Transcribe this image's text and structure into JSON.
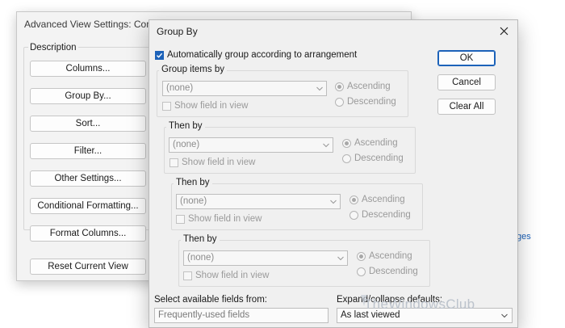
{
  "background_dialog": {
    "title": "Advanced View Settings: Com",
    "description_label": "Description",
    "buttons": [
      "Columns...",
      "Group By...",
      "Sort...",
      "Filter...",
      "Other Settings...",
      "Conditional Formatting...",
      "Format Columns..."
    ],
    "reset_label": "Reset Current View",
    "right_link_partial": "ges"
  },
  "dialog": {
    "title": "Group By",
    "auto_group_label": "Automatically group according to arrangement",
    "auto_group_checked": true,
    "groups": [
      {
        "label": "Group items by",
        "value": "(none)",
        "show_field": "Show field in view",
        "ascending": "Ascending",
        "descending": "Descending"
      },
      {
        "label": "Then by",
        "value": "(none)",
        "show_field": "Show field in view",
        "ascending": "Ascending",
        "descending": "Descending"
      },
      {
        "label": "Then by",
        "value": "(none)",
        "show_field": "Show field in view",
        "ascending": "Ascending",
        "descending": "Descending"
      },
      {
        "label": "Then by",
        "value": "(none)",
        "show_field": "Show field in view",
        "ascending": "Ascending",
        "descending": "Descending"
      }
    ],
    "ok_label": "OK",
    "cancel_label": "Cancel",
    "clear_all_label": "Clear All",
    "fields_from_label": "Select available fields from:",
    "fields_from_value": "Frequently-used fields",
    "expand_collapse_label": "Expand/collapse defaults:",
    "expand_collapse_value": "As last viewed"
  },
  "watermark": "TheWindowsClub",
  "colors": {
    "accent": "#1c62b9",
    "dialog_bg": "#f0f0f0"
  },
  "icons": {
    "close": "close-icon",
    "dropdown": "chevron-down-icon",
    "check": "checkmark-icon"
  }
}
